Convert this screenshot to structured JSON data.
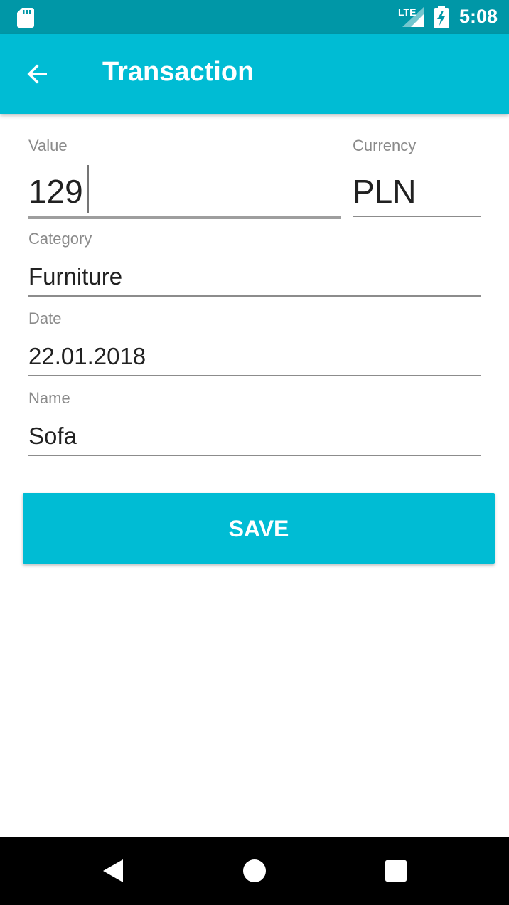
{
  "status_bar": {
    "network": "LTE",
    "time": "5:08",
    "icons": [
      "sd-card-icon",
      "signal-icon",
      "battery-charging-icon"
    ]
  },
  "app_bar": {
    "back_icon": "arrow-back-icon",
    "title": "Transaction"
  },
  "form": {
    "value": {
      "label": "Value",
      "text": "129"
    },
    "currency": {
      "label": "Currency",
      "text": "PLN"
    },
    "category": {
      "label": "Category",
      "text": "Furniture"
    },
    "date": {
      "label": "Date",
      "text": "22.01.2018"
    },
    "name": {
      "label": "Name",
      "text": "Sofa"
    }
  },
  "save_button": {
    "label": "SAVE"
  },
  "colors": {
    "status_bar": "#0097a7",
    "primary": "#00bcd4",
    "label_text": "#8a8a8a",
    "input_text": "#212121"
  },
  "nav_bar": {
    "icons": [
      "back-triangle-icon",
      "home-circle-icon",
      "recents-square-icon"
    ]
  }
}
